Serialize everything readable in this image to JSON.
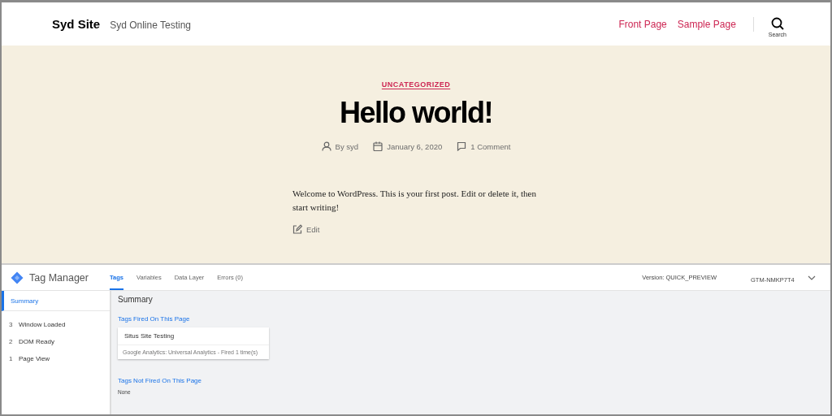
{
  "site": {
    "title": "Syd Site",
    "tagline": "Syd Online Testing",
    "nav": [
      {
        "label": "Front Page"
      },
      {
        "label": "Sample Page"
      }
    ],
    "search_label": "Search"
  },
  "post": {
    "category": "UNCATEGORIZED",
    "title": "Hello world!",
    "meta": [
      {
        "kind": "author",
        "text": "By syd"
      },
      {
        "kind": "date",
        "text": "January 6, 2020"
      },
      {
        "kind": "comments",
        "text": "1 Comment"
      }
    ],
    "body": "Welcome to WordPress. This is your first post. Edit or delete it, then start writing!",
    "edit_label": "Edit"
  },
  "tag_manager": {
    "product": "Tag Manager",
    "tabs": [
      {
        "label": "Tags",
        "selected": true
      },
      {
        "label": "Variables",
        "selected": false
      },
      {
        "label": "Data Layer",
        "selected": false
      },
      {
        "label": "Errors (0)",
        "selected": false
      }
    ],
    "version": "Version: QUICK_PREVIEW",
    "container_id": "GTM-NMKP7T4",
    "sidebar": [
      {
        "label": "Summary",
        "selected": true
      },
      {
        "number": "3",
        "label": "Window Loaded",
        "selected": false
      },
      {
        "number": "2",
        "label": "DOM Ready",
        "selected": false
      },
      {
        "number": "1",
        "label": "Page View",
        "selected": false
      }
    ],
    "summary_title": "Summary",
    "fired_heading": "Tags Fired On This Page",
    "fired_tags": [
      {
        "name": "Situs Site Testing",
        "detail": "Google Analytics: Universal Analytics - Fired 1 time(s)"
      }
    ],
    "not_fired_heading": "Tags Not Fired On This Page",
    "not_fired_text": "None"
  }
}
